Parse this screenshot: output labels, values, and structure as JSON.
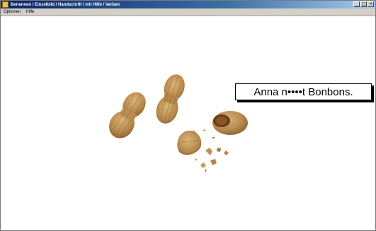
{
  "window": {
    "title": "Benennen / Einzelbild / Handschrift / mit Hilfe / Verben",
    "minimize_label": "_",
    "maximize_label": "□",
    "close_label": "×"
  },
  "menu": {
    "items": [
      "Optionen",
      "Hilfe"
    ]
  },
  "stimulus": {
    "sentence": "Anna n••••t Bonbons.",
    "image_subject": "peanuts"
  }
}
